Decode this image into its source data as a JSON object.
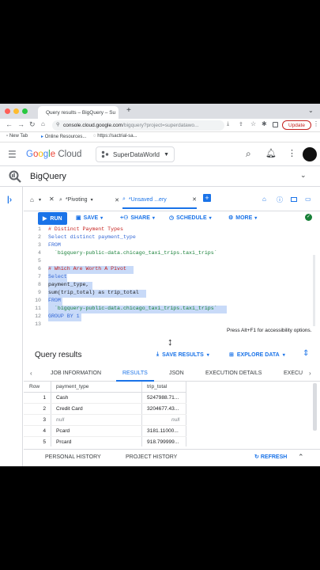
{
  "browser": {
    "tab_title": "Query results – BigQuery – Su",
    "url_host": "console.cloud.google.com",
    "url_path": "/bigquery?project=superdatawo...",
    "update_label": "Update",
    "bookmarks": [
      "New Tab",
      "Online Resources...",
      "https://sactrial-sa..."
    ]
  },
  "console": {
    "logo": "Google Cloud",
    "project": "SuperDataWorld",
    "product": "BigQuery"
  },
  "editor_tabs": [
    {
      "label": "*Pivoting"
    },
    {
      "label": "*Unsaved ...ery"
    }
  ],
  "toolbar": {
    "run": "RUN",
    "save": "SAVE",
    "share": "SHARE",
    "schedule": "SCHEDULE",
    "more": "MORE"
  },
  "editor": {
    "lines": [
      {
        "n": "1",
        "text": "# Distinct Payment Types"
      },
      {
        "n": "2",
        "text": "Select distinct payment_type"
      },
      {
        "n": "3",
        "text": "FROM"
      },
      {
        "n": "4",
        "text": "  `bigquery-public-data.chicago_taxi_trips.taxi_trips`"
      },
      {
        "n": "5",
        "text": ""
      },
      {
        "n": "6",
        "text": "# Which Are Worth A Pivot"
      },
      {
        "n": "7",
        "text": "Select"
      },
      {
        "n": "8",
        "text": "payment_type,"
      },
      {
        "n": "9",
        "text": "sum(trip_total) as trip_total"
      },
      {
        "n": "10",
        "text": "FROM"
      },
      {
        "n": "11",
        "text": "  `bigquery-public-data.chicago_taxi_trips.taxi_trips`"
      },
      {
        "n": "12",
        "text": "GROUP BY 1"
      },
      {
        "n": "13",
        "text": ""
      }
    ],
    "hint": "Press Alt+F1 for accessibility options."
  },
  "results": {
    "title": "Query results",
    "save_results": "SAVE RESULTS",
    "explore_data": "EXPLORE DATA",
    "tabs": [
      "JOB INFORMATION",
      "RESULTS",
      "JSON",
      "EXECUTION DETAILS",
      "EXECU"
    ],
    "columns": [
      "Row",
      "payment_type",
      "trip_total"
    ],
    "rows": [
      {
        "row": "1",
        "payment_type": "Cash",
        "trip_total": "5247988.71..."
      },
      {
        "row": "2",
        "payment_type": "Credit Card",
        "trip_total": "3204677.43..."
      },
      {
        "row": "3",
        "payment_type": "null",
        "trip_total": "null"
      },
      {
        "row": "4",
        "payment_type": "Pcard",
        "trip_total": "3181.11000..."
      },
      {
        "row": "5",
        "payment_type": "Prcard",
        "trip_total": "918.799999..."
      }
    ]
  },
  "bottom": {
    "personal_history": "PERSONAL HISTORY",
    "project_history": "PROJECT HISTORY",
    "refresh": "REFRESH"
  },
  "colors": {
    "accent": "#1a73e8",
    "run_button": "#1a73e8",
    "selection": "#c8daf8",
    "comment": "#c5221f",
    "keyword": "#3367d6",
    "string": "#188038"
  }
}
